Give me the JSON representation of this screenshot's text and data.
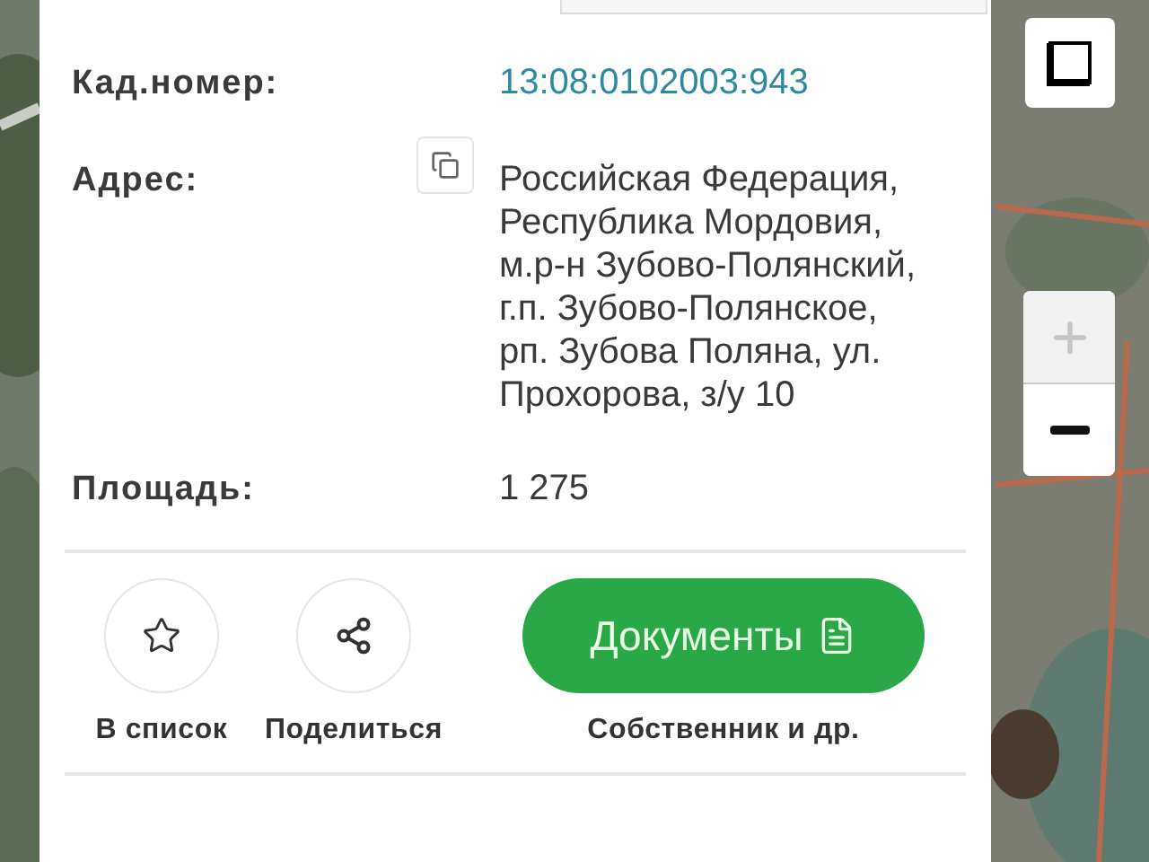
{
  "card": {
    "fields": [
      {
        "label": "Кад.номер:",
        "value": "13:08:0102003:943",
        "kind": "link",
        "copyable": false
      },
      {
        "label": "Адрес:",
        "value": "Российская Федерация, Республика Мордовия, м.р-н Зубово-Полянский, г.п. Зубово-Полянское, рп. Зубова Поляна, ул. Прохорова, з/у 10",
        "kind": "text",
        "copyable": true
      },
      {
        "label": "Площадь:",
        "value": "1 275",
        "kind": "text",
        "copyable": false
      }
    ],
    "actions": [
      {
        "kind": "favorite",
        "caption": "В список"
      },
      {
        "kind": "share",
        "caption": "Поделиться"
      },
      {
        "kind": "documents",
        "button_text": "Документы",
        "caption": "Собственник и др."
      }
    ]
  },
  "map_controls": {
    "zoom_in": {
      "disabled": true
    },
    "zoom_out": {
      "disabled": false
    }
  }
}
